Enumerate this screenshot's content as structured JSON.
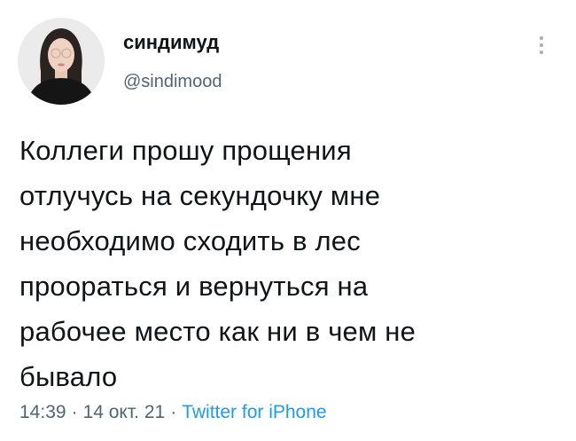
{
  "user": {
    "display_name": "синдимуд",
    "handle": "@sindimood"
  },
  "menu": {
    "icon": "more-vertical-icon"
  },
  "tweet": {
    "text": "Коллеги прошу прощения\nотлучусь на секундочку мне\nнеобходимо сходить в лес\nпроораться и вернуться на\nрабочее место как ни в чем не\nбывало"
  },
  "meta": {
    "time": "14:39",
    "separator": "·",
    "date": "14 окт. 21",
    "source": "Twitter for iPhone"
  },
  "colors": {
    "text": "#0f1419",
    "secondary": "#536471",
    "link": "#1d9bf0"
  }
}
